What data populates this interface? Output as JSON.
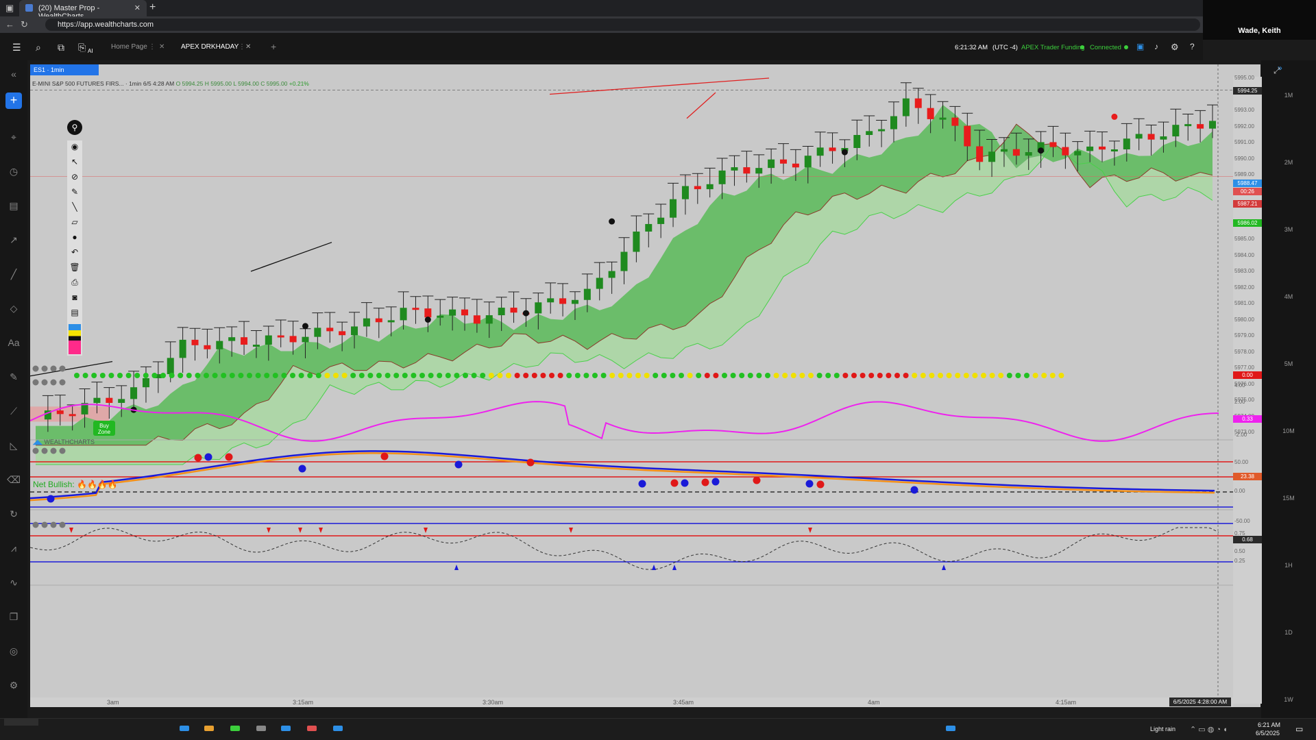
{
  "browser": {
    "tab_title": "(20) Master Prop - WealthCharts",
    "url": "https://app.wealthcharts.com"
  },
  "user": {
    "name": "Wade, Keith"
  },
  "app": {
    "tabs": [
      {
        "label": "Home Page",
        "active": false
      },
      {
        "label": "APEX DRKHADAY",
        "active": true
      }
    ],
    "clock": "6:21:32 AM",
    "timezone": "(UTC -4)",
    "account": "APEX Trader Funding",
    "connection": "Connected",
    "ai_label": "AI"
  },
  "chart": {
    "symbol_tag": "ES1 · 1min",
    "instrument": "E-MINI S&P 500 FUTURES FIRS... · 1min",
    "ohlc": {
      "date": "6/5 4:28 AM",
      "open": "O 5994.25",
      "high": "H 5995.00",
      "low": "L 5994.00",
      "close": "C 5995.00",
      "change": "+0.21%"
    },
    "net_bullish_label": "Net Bullish:",
    "buy_zone_label": "Buy Zone",
    "logo_text": "WEALTHCHARTS",
    "price_labels": [
      "5995.00",
      "5993.00",
      "5992.00",
      "5991.00",
      "5990.00",
      "5989.00",
      "5985.00",
      "5984.00",
      "5983.00",
      "5982.00",
      "5981.00",
      "5980.00",
      "5979.00",
      "5978.00",
      "5977.00",
      "5976.00",
      "5975.00",
      "5974.00",
      "5973.00"
    ],
    "price_badges": [
      {
        "text": "5994.25",
        "color": "#2a2a2a"
      },
      {
        "text": "5988.47",
        "color": "#2d8fe6"
      },
      {
        "text": "00:26",
        "color": "#e05050"
      },
      {
        "text": "5987.21",
        "color": "#d33a3a"
      },
      {
        "text": "5986.02",
        "color": "#22b822"
      }
    ],
    "dots_value": "0.00",
    "osc_labels": [
      "4.00",
      "2.00",
      "-2.00"
    ],
    "osc_value": "0.33",
    "stoch_labels": [
      "50.00",
      "0.00",
      "-50.00"
    ],
    "stoch_value": "23.38",
    "fourth_labels": [
      "0.75",
      "0.50",
      "0.25"
    ],
    "fourth_value": "0.68",
    "time_labels": [
      "3am",
      "3:15am",
      "3:30am",
      "3:45am",
      "4am",
      "4:15am"
    ],
    "time_cursor": "6/5/2025 4:28:00 AM"
  },
  "timeframes": [
    "1M",
    "2M",
    "3M",
    "4M",
    "5M",
    "10M",
    "15M",
    "1H",
    "1D",
    "1W"
  ],
  "taskbar": {
    "weather": "Light rain",
    "time": "6:21 AM",
    "date": "6/5/2025"
  },
  "colors": {
    "bull": "#1f8a1f",
    "bear": "#e81c1c",
    "accent": "#2274e8",
    "chart_bg": "#c9c9c9"
  }
}
